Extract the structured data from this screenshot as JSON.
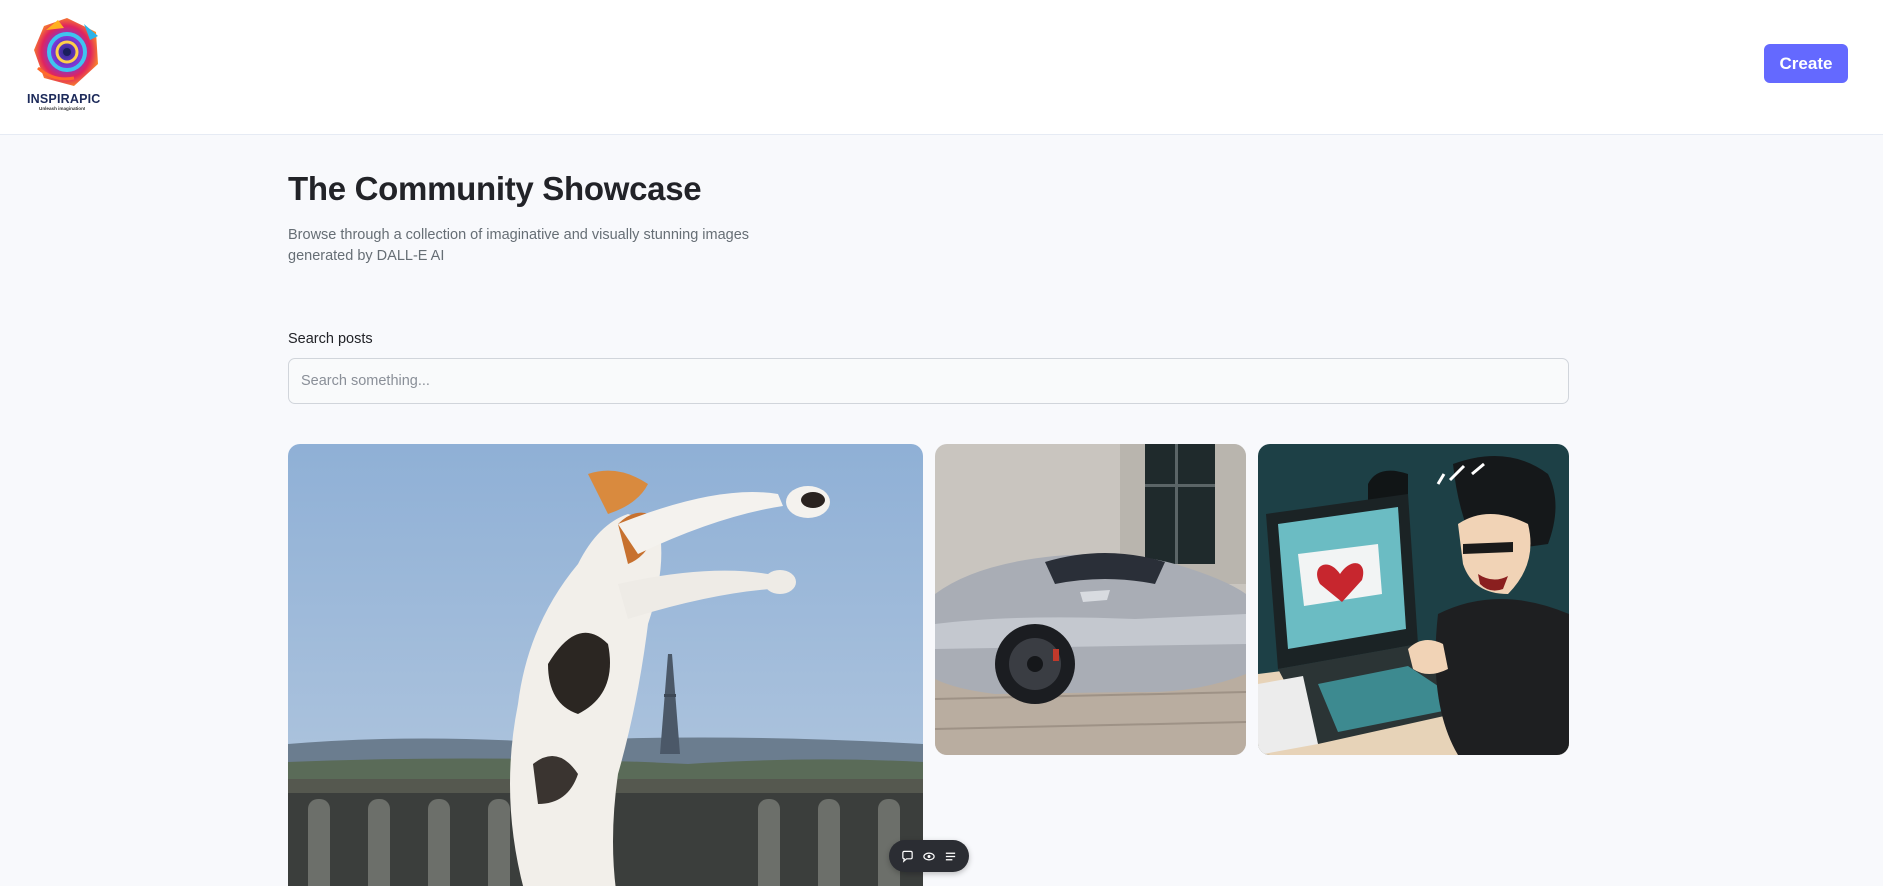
{
  "header": {
    "logo_name": "INSPIRAPIC",
    "logo_tagline": "Unleash imagination!",
    "create_label": "Create"
  },
  "main": {
    "title": "The Community Showcase",
    "subtitle": "Browse through a collection of imaginative and visually stunning images generated by DALL-E AI",
    "search_label": "Search posts",
    "search_placeholder": "Search something..."
  },
  "posts": [
    {
      "subject": "calico-cat-paris"
    },
    {
      "subject": "silver-sports-car"
    },
    {
      "subject": "person-typing-laptop-heart"
    }
  ],
  "toolbar": {
    "icons": [
      "comment-icon",
      "eye-icon",
      "list-icon"
    ]
  },
  "colors": {
    "accent": "#6469ff",
    "title": "#222328",
    "subtitle": "#666e75",
    "background": "#f8f9fc"
  }
}
